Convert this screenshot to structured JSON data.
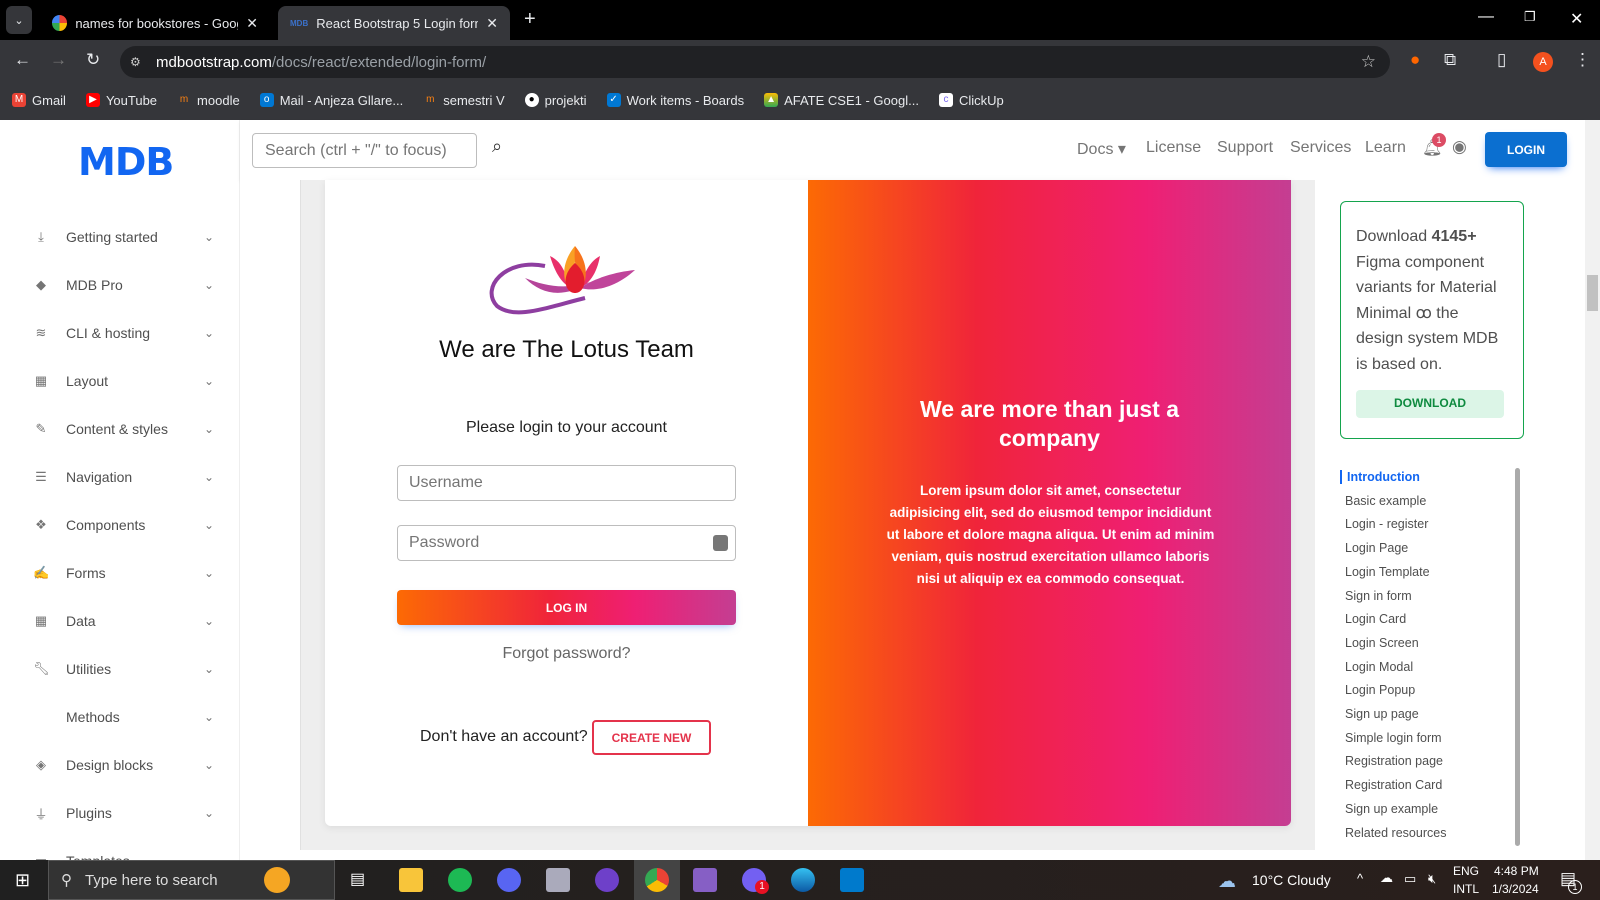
{
  "browser": {
    "tabs": [
      {
        "title": "names for bookstores - Google",
        "active": false
      },
      {
        "title": "React Bootstrap 5 Login form -",
        "active": true
      }
    ],
    "new_tab": "+",
    "url_domain": "mdbootstrap.com",
    "url_path": "/docs/react/extended/login-form/",
    "profile_initial": "A",
    "bookmarks": [
      {
        "label": "Gmail",
        "color": "#ea4335"
      },
      {
        "label": "YouTube",
        "color": "#ff0000"
      },
      {
        "label": "moodle",
        "color": "#f98012"
      },
      {
        "label": "Mail - Anjeza Gllare...",
        "color": "#0078d4"
      },
      {
        "label": "semestri V",
        "color": "#f98012"
      },
      {
        "label": "projekti",
        "color": "#ffffff"
      },
      {
        "label": "Work items - Boards",
        "color": "#0078d4"
      },
      {
        "label": "AFATE CSE1 - Googl...",
        "color": "#34a853"
      },
      {
        "label": "ClickUp",
        "color": "#7b68ee"
      }
    ]
  },
  "sidebar": {
    "logo": "MDB",
    "items": [
      {
        "label": "Getting started",
        "icon": "download-icon"
      },
      {
        "label": "MDB Pro",
        "icon": "gem-icon"
      },
      {
        "label": "CLI & hosting",
        "icon": "database-icon"
      },
      {
        "label": "Layout",
        "icon": "table-icon"
      },
      {
        "label": "Content & styles",
        "icon": "brush-icon"
      },
      {
        "label": "Navigation",
        "icon": "bars-icon"
      },
      {
        "label": "Components",
        "icon": "cubes-icon"
      },
      {
        "label": "Forms",
        "icon": "edit-icon"
      },
      {
        "label": "Data",
        "icon": "table-icon"
      },
      {
        "label": "Utilities",
        "icon": "wrench-icon"
      },
      {
        "label": "Methods",
        "icon": "code-icon"
      },
      {
        "label": "Design blocks",
        "icon": "layer-icon"
      },
      {
        "label": "Plugins",
        "icon": "plug-icon"
      },
      {
        "label": "Templates",
        "icon": "file-icon"
      }
    ]
  },
  "header": {
    "search_placeholder": "Search (ctrl + \"/\" to focus)",
    "nav": [
      "Docs",
      "License",
      "Support",
      "Services",
      "Learn"
    ],
    "notifications": "1",
    "login": "LOGIN",
    "accent": "#0b6fd0"
  },
  "card": {
    "title": "We are The Lotus Team",
    "subtitle": "Please login to your account",
    "username_placeholder": "Username",
    "password_placeholder": "Password",
    "login": "LOG IN",
    "forgot": "Forgot password?",
    "no_account": "Don't have an account?",
    "create": "CREATE NEW",
    "promo_title": "We are more than just a company",
    "promo_text": "Lorem ipsum dolor sit amet, consectetur adipisicing elit, sed do eiusmod tempor incididunt ut labore et dolore magna aliqua. Ut enim ad minim veniam, quis nostrud exercitation ullamco laboris nisi ut aliquip ex ea commodo consequat."
  },
  "aside": {
    "promo_pre": "Download ",
    "promo_count": "4145+",
    "promo_mid": " Figma component variants for Material Minimal ",
    "promo_post": " the design system MDB is based on.",
    "download": "DOWNLOAD",
    "toc": [
      "Introduction",
      "Basic example",
      "Login - register",
      "Login Page",
      "Login Template",
      "Sign in form",
      "Login Card",
      "Login Screen",
      "Login Modal",
      "Login Popup",
      "Sign up page",
      "Simple login form",
      "Registration page",
      "Registration Card",
      "Sign up example",
      "Related resources"
    ],
    "toc_active": "Introduction"
  },
  "taskbar": {
    "search_placeholder": "Type here to search",
    "weather": "10°C  Cloudy",
    "lang1": "ENG",
    "lang2": "INTL",
    "time": "4:48 PM",
    "date": "1/3/2024",
    "viber_badge": "1",
    "notif_badge": "1"
  }
}
